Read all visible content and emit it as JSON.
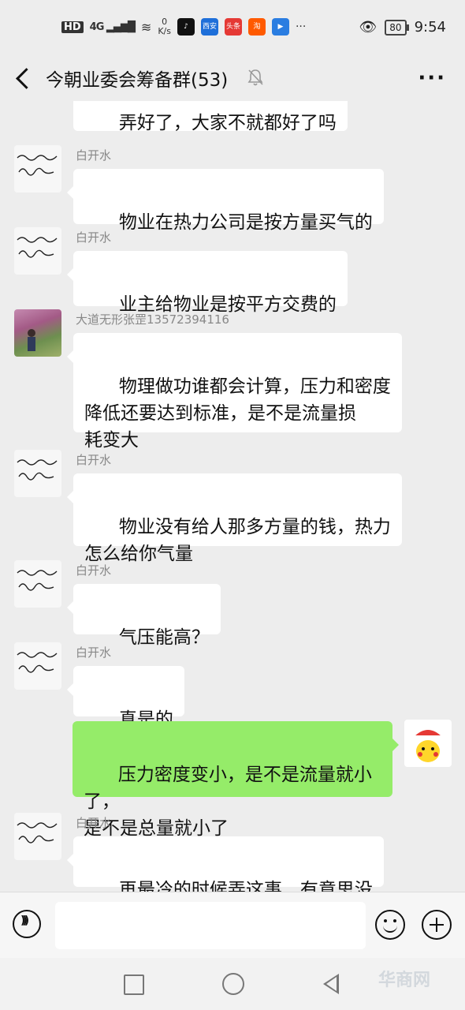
{
  "status_bar": {
    "hd": "HD",
    "network": "4G",
    "speed_value": "0",
    "speed_unit": "K/s",
    "app_icons": [
      {
        "name": "tiktok-icon",
        "label": "♪",
        "color": "#111111"
      },
      {
        "name": "news-app-icon",
        "label": "西安",
        "color": "#1e6fd9"
      },
      {
        "name": "red-app-icon",
        "label": "头条",
        "color": "#e53935"
      },
      {
        "name": "taobao-icon",
        "label": "淘",
        "color": "#ff5a00"
      },
      {
        "name": "video-app-icon",
        "label": "▶",
        "color": "#2a7de1"
      }
    ],
    "more": "···",
    "battery": "80",
    "time": "9:54"
  },
  "header": {
    "title": "今朝业委会筹备群(53)"
  },
  "messages": [
    {
      "sender": "",
      "text": "弄好了，大家不就都好了吗",
      "side": "left",
      "avatar": "calligraphy"
    },
    {
      "sender": "白开水",
      "text": "物业在热力公司是按方量买气的",
      "side": "left",
      "avatar": "calligraphy"
    },
    {
      "sender": "白开水",
      "text": "业主给物业是按平方交费的",
      "side": "left",
      "avatar": "calligraphy"
    },
    {
      "sender": "大道无形张罡13572394116",
      "text": "物理做功谁都会计算，压力和密度\n降低还要达到标准，是不是流量损\n耗变大",
      "side": "left",
      "avatar": "photo"
    },
    {
      "sender": "白开水",
      "text": "物业没有给人那多方量的钱，热力\n怎么给你气量",
      "side": "left",
      "avatar": "calligraphy"
    },
    {
      "sender": "白开水",
      "text": "气压能高？",
      "side": "left",
      "avatar": "calligraphy"
    },
    {
      "sender": "白开水",
      "text": "真是的",
      "side": "left",
      "avatar": "calligraphy"
    },
    {
      "sender": "",
      "text": "压力密度变小，是不是流量就小了，\n是不是总量就小了",
      "side": "right",
      "avatar": "pikachu"
    },
    {
      "sender": "白开水",
      "text": "再最冷的时候弄这事，有意思没",
      "side": "left",
      "avatar": "calligraphy"
    }
  ],
  "input_bar": {
    "placeholder": ""
  },
  "watermark": "华商网"
}
